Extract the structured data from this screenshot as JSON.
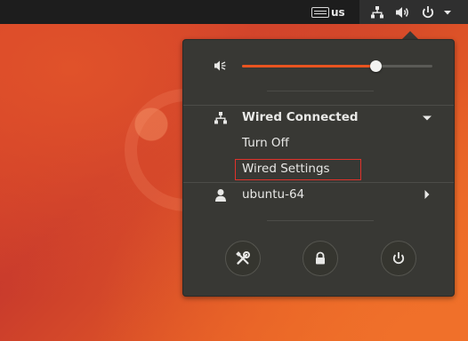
{
  "colors": {
    "accent": "#e95420",
    "menu_bg": "#383834",
    "topbar_bg": "#1d1d1d",
    "highlight_border": "#e0322b"
  },
  "topbar": {
    "keyboard_layout": "us",
    "icons": [
      "keyboard-icon",
      "network-wired-icon",
      "volume-icon",
      "power-icon",
      "dropdown-arrow-icon"
    ]
  },
  "menu": {
    "volume": {
      "level": 0.7,
      "icon": "volume-speaker-icon"
    },
    "network": {
      "title": "Wired Connected",
      "icon": "network-wired-icon",
      "items": [
        {
          "label": "Turn Off"
        },
        {
          "label": "Wired Settings"
        }
      ]
    },
    "user": {
      "label": "ubuntu-64",
      "icon": "user-icon"
    },
    "actions": [
      "settings-icon",
      "lock-icon",
      "power-icon"
    ]
  }
}
